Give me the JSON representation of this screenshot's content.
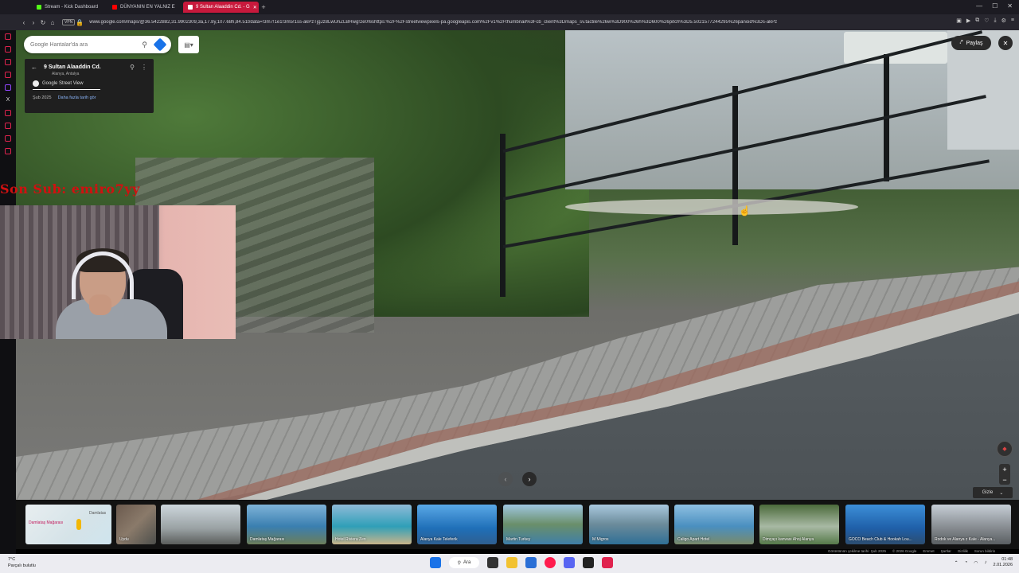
{
  "browser": {
    "tabs": [
      {
        "label": "Stream - Kick Dashboard",
        "color": "#53fc18"
      },
      {
        "label": "DÜNYANIN EN YALNIZ E",
        "color": "#ff0000"
      },
      {
        "label": "9 Sultan Alaaddin Cd. - G",
        "color": "#ffffff",
        "active": true
      }
    ],
    "url": "www.google.com/maps/@36.5422882,31.9902309,3a,17.8y,107.68h,84.51t/data=!3m7!1e1!3m5!1ss-akPzTjgJz8LwUnZLBHwg!2e0!6shttps:%2F%2Fstreetviewpixels-pa.googleapis.com%2Fv1%2Fthumbnail%3Fcb_client%3Dmaps_sv.tactile%26w%3D900%26h%3D600%26pitch%3D5.5021577244295%26panoid%3Ds-akPz",
    "vpn_label": "VPN"
  },
  "search": {
    "placeholder": "Google Haritalar'da ara"
  },
  "place_card": {
    "title": "9 Sultan Alaaddin Cd.",
    "subtitle": "Alanya, Antalya",
    "source": "Google Street View",
    "date": "Şub 2025",
    "more_dates": "Daha fazla tarih gör"
  },
  "controls": {
    "share_label": "Paylaş",
    "hide_label": "Gizle"
  },
  "overlay": {
    "sub_text": "Son Sub: emiro7yy"
  },
  "photo_strip": [
    {
      "caption": ""
    },
    {
      "caption": "Uydu"
    },
    {
      "caption": ""
    },
    {
      "caption": "Damlataş Mağarası"
    },
    {
      "caption": "Hotel Riviera Zen"
    },
    {
      "caption": "Alanya Kale Teleferik"
    },
    {
      "caption": "Martin Turkey"
    },
    {
      "caption": "M Migros"
    },
    {
      "caption": "Caligo Apart Hotel"
    },
    {
      "caption": "Dimçayı kanvası Ahoj Alanya"
    },
    {
      "caption": "GOCO Beach Club & Hookah Lou..."
    },
    {
      "caption": "Rodok ve Alanya z Kale - Alanya..."
    }
  ],
  "map_thumb": {
    "label_cave": "Damlataş Mağarası",
    "label_road": "Damlatas"
  },
  "footer": {
    "capture": "Görüntünün çekilme tarihi: Şub 2025",
    "copyright": "© 2026 Google",
    "links": [
      "Emmet",
      "Şartlar",
      "Gizlilik",
      "Sorun bildirin"
    ]
  },
  "taskbar": {
    "temperature": "7°C",
    "weather": "Parçalı bulutlu",
    "search_label": "Ara",
    "time": "01:48",
    "date": "2.01.2026"
  }
}
